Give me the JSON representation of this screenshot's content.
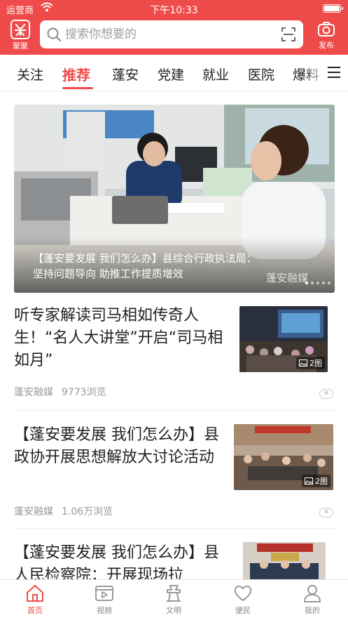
{
  "status_bar": {
    "carrier": "运营商",
    "time": "下午10:33",
    "battery_level": 1.0
  },
  "header": {
    "logo_label": "聚聚",
    "search_placeholder": "搜索你想要的",
    "publish_label": "发布",
    "accent_color": "#f04b4b"
  },
  "tabs": {
    "items": [
      "关注",
      "推荐",
      "蓬安",
      "党建",
      "就业",
      "医院",
      "爆料"
    ],
    "active": "推荐"
  },
  "hero": {
    "caption": "【蓬安要发展 我们怎么办】县综合行政执法局：坚持问题导向 助推工作提质增效",
    "watermark": "蓬安融媒",
    "slide_count": 5,
    "current_slide": 1
  },
  "articles": [
    {
      "title": "听专家解读司马相如传奇人生！“名人大讲堂”开启“司马相如月”",
      "source": "蓬安融媒",
      "views": "9773浏览",
      "image_count": "2图",
      "thumb_icon": "lecture-photo"
    },
    {
      "title": "【蓬安要发展 我们怎么办】县政协开展思想解放大讨论活动",
      "source": "蓬安融媒",
      "views": "1.06万浏览",
      "image_count": "2图",
      "thumb_icon": "meeting-photo"
    },
    {
      "title": "【蓬安要发展 我们怎么办】县人民检察院：开展现场拉",
      "thumb_icon": "procuratorate-photo"
    }
  ],
  "bottom_nav": {
    "items": [
      {
        "label": "首页",
        "icon": "home-icon"
      },
      {
        "label": "视频",
        "icon": "video-icon"
      },
      {
        "label": "文明",
        "icon": "civilization-icon"
      },
      {
        "label": "便民",
        "icon": "heart-icon"
      },
      {
        "label": "我的",
        "icon": "user-icon"
      }
    ],
    "active": "首页"
  }
}
